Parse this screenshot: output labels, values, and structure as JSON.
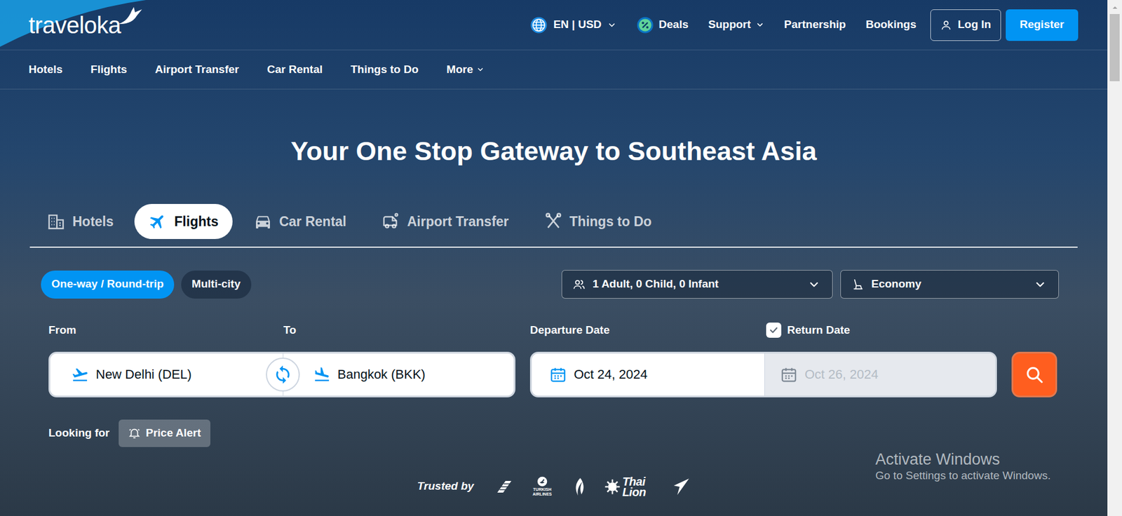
{
  "header": {
    "logo": "traveloka",
    "locale": "EN | USD",
    "links": [
      {
        "label": "Deals",
        "kind": "deals"
      },
      {
        "label": "Support",
        "kind": "menu"
      },
      {
        "label": "Partnership",
        "kind": "plain"
      },
      {
        "label": "Bookings",
        "kind": "plain"
      }
    ],
    "login": "Log In",
    "register": "Register"
  },
  "nav": [
    {
      "label": "Hotels",
      "kind": "plain"
    },
    {
      "label": "Flights",
      "kind": "plain"
    },
    {
      "label": "Airport Transfer",
      "kind": "plain"
    },
    {
      "label": "Car Rental",
      "kind": "plain"
    },
    {
      "label": "Things to Do",
      "kind": "plain"
    },
    {
      "label": "More",
      "kind": "menu"
    }
  ],
  "hero": {
    "title": "Your One Stop Gateway to Southeast Asia"
  },
  "products": [
    {
      "label": "Hotels",
      "kind": "hotel",
      "selected": false
    },
    {
      "label": "Flights",
      "kind": "flight",
      "selected": true
    },
    {
      "label": "Car Rental",
      "kind": "car",
      "selected": false
    },
    {
      "label": "Airport Transfer",
      "kind": "transfer",
      "selected": false
    },
    {
      "label": "Things to Do",
      "kind": "activity",
      "selected": false
    }
  ],
  "trip_types": [
    {
      "label": "One-way / Round-trip",
      "selected": true
    },
    {
      "label": "Multi-city",
      "selected": false
    }
  ],
  "passengers": "1 Adult, 0 Child, 0 Infant",
  "cabin_class": "Economy",
  "from": {
    "label": "From",
    "value": "New Delhi (DEL)"
  },
  "to": {
    "label": "To",
    "value": "Bangkok (BKK)"
  },
  "departure": {
    "label": "Departure Date",
    "value": "Oct 24, 2024"
  },
  "return_date": {
    "label": "Return Date",
    "checked": true,
    "disabled": true,
    "value": "Oct 26, 2024"
  },
  "looking_for": {
    "label": "Looking for",
    "button": "Price Alert"
  },
  "trusted_by": {
    "label": "Trusted by",
    "airlines": [
      {
        "kind": "stripes"
      },
      {
        "kind": "turkish",
        "text": "TURKISH AIRLINES"
      },
      {
        "kind": "flame"
      },
      {
        "kind": "lion",
        "text": "Thai Lion"
      },
      {
        "kind": "arrow"
      }
    ]
  },
  "watermark": {
    "title": "Activate Windows",
    "subtitle": "Go to Settings to activate Windows."
  }
}
